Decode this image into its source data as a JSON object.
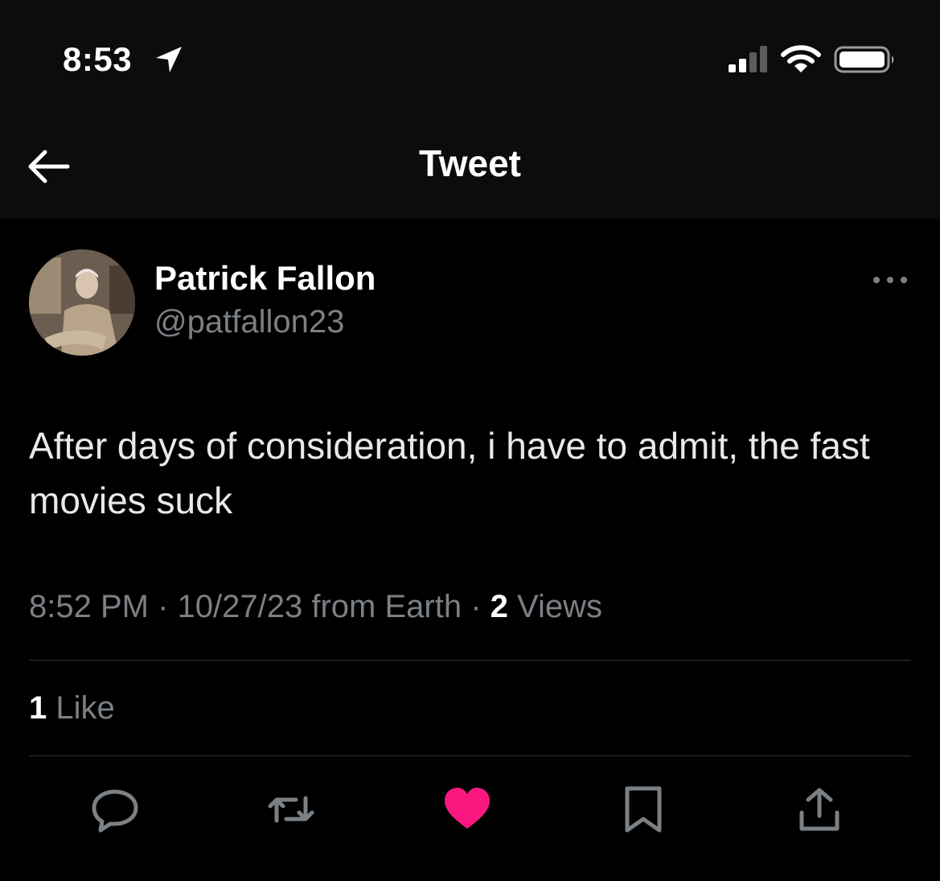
{
  "status_bar": {
    "time": "8:53",
    "icons": [
      "location-arrow-icon",
      "cellular-signal-icon",
      "wifi-icon",
      "battery-icon"
    ]
  },
  "header": {
    "title": "Tweet",
    "back_icon": "back-arrow-icon"
  },
  "tweet": {
    "author_name": "Patrick Fallon",
    "author_handle": "@patfallon23",
    "text": "After days of consideration, i have to admit, the fast movies suck",
    "time": "8:52 PM",
    "date": "10/27/23",
    "source": "from Earth",
    "separator": "·",
    "views_count": "2",
    "views_label": "Views",
    "likes_count": "1",
    "likes_label": "Like"
  },
  "actions": [
    "reply-icon",
    "retweet-icon",
    "like-icon",
    "bookmark-icon",
    "share-icon"
  ],
  "colors": {
    "background": "#000000",
    "header_background": "#0c0c0c",
    "text_primary": "#ffffff",
    "text_secondary": "#7b8085",
    "divider": "#2f3336",
    "like_active": "#f91880"
  }
}
